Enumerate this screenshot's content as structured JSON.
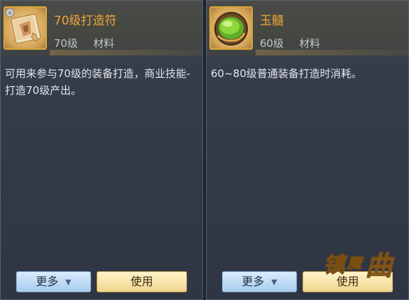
{
  "left_item": {
    "name": "70级打造符",
    "level": "70级",
    "category": "材料",
    "description": "可用来参与70级的装备打造，商业技能-打造70级产出。",
    "more_label": "更多",
    "use_label": "使用",
    "icon": "scroll-icon"
  },
  "right_item": {
    "name": "玉髓",
    "level": "60级",
    "category": "材料",
    "description": "60~80级普通装备打造时消耗。",
    "more_label": "更多",
    "use_label": "使用",
    "icon": "green-gem-icon"
  },
  "logo": {
    "text": "镇魔曲"
  },
  "colors": {
    "item_name": "#f0a53a",
    "icon_border": "#d8a83c",
    "more_button": "#b7d6f2",
    "use_button": "#f4dfa0"
  }
}
